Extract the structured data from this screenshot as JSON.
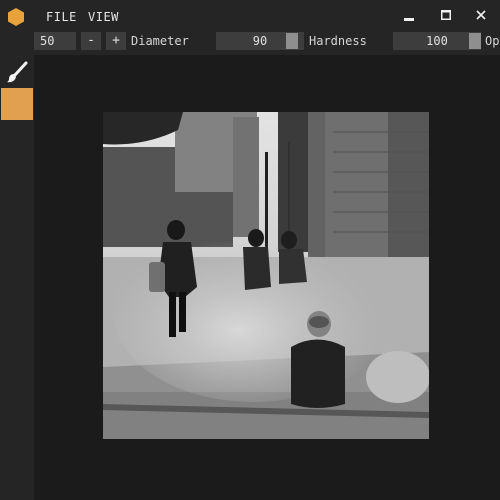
{
  "menu": {
    "file": "FILE",
    "view": "VIEW"
  },
  "window": {
    "minimize_glyph": "▬",
    "maximize_glyph": "▢",
    "close_glyph": "✕"
  },
  "toolbar": {
    "diameter_value": "50",
    "minus_label": "-",
    "plus_label": "+",
    "diameter_label": "Diameter",
    "hardness_value": "90",
    "hardness_label": "Hardness",
    "opacity_value": "100",
    "opacity_label_visible": "Op"
  },
  "tools": {
    "active_tool": "brush-icon"
  },
  "colors": {
    "accent": "#e0a050",
    "logo": "#e8a33d",
    "background": "#1e1e1e",
    "panel": "#252525"
  },
  "canvas": {
    "content": "black-and-white street photograph"
  }
}
